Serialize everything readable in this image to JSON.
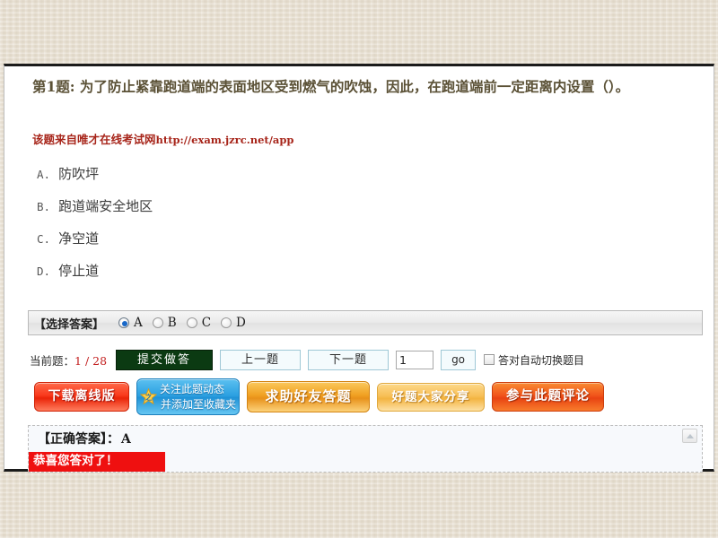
{
  "question": {
    "stem": "第1题: 为了防止紧靠跑道端的表面地区受到燃气的吹蚀，因此，在跑道端前一定距离内设置（）。",
    "source_prefix": "该题来自唯才在线考试网",
    "source_url": "http://exam.jzrc.net/app",
    "options": [
      {
        "letter": "A.",
        "text": "防吹坪"
      },
      {
        "letter": "B.",
        "text": "跑道端安全地区"
      },
      {
        "letter": "C.",
        "text": "净空道"
      },
      {
        "letter": "D.",
        "text": "停止道"
      }
    ]
  },
  "answer_select": {
    "label": "【选择答案】",
    "choices": [
      {
        "value": "A",
        "checked": true
      },
      {
        "value": "B",
        "checked": false
      },
      {
        "value": "C",
        "checked": false
      },
      {
        "value": "D",
        "checked": false
      }
    ]
  },
  "toolbar": {
    "current_label": "当前题：",
    "current_count": "1 / 28",
    "submit_label": "提交做答",
    "prev_label": "上一题",
    "next_label": "下一题",
    "jump_value": "1",
    "jump_placeholder": "",
    "go_label": "go",
    "auto_next_label": "答对自动切换题目",
    "auto_next_checked": false
  },
  "actions": {
    "download_offline": "下载离线版",
    "follow_line1": "关注此题动态",
    "follow_line2": "并添加至收藏夹",
    "follow_star_glyph": "之",
    "ask_friend": "求助好友答题",
    "share_question": "好题大家分享",
    "comment_question": "参与此题评论"
  },
  "result": {
    "correct_answer_label": "【正确答案】：",
    "correct_answer_value": "A",
    "banner_text": "恭喜您答对了！",
    "collapse_icon_name": "collapse-arrow-icon"
  },
  "colors": {
    "page_background": "#e7dfd1",
    "panel_background": "#ffffff",
    "stem_text": "#5b5136",
    "source_red": "#a7251a",
    "counter_red": "#c32020",
    "submit_green": "#0b3a12",
    "radio_accent": "#1767c8",
    "banner_red": "#ef1010",
    "download_red": "#ea2408",
    "follow_blue": "#1f92d6",
    "ask_gold": "#e8911a",
    "share_gold": "#f3b441",
    "comment_orange": "#e84312"
  }
}
